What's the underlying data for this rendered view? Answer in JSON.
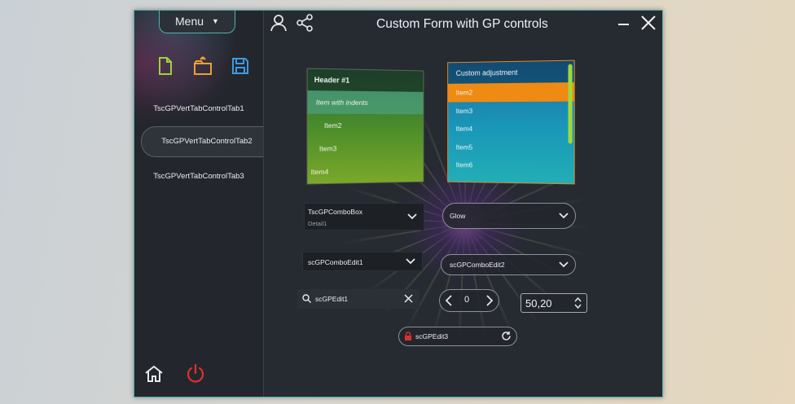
{
  "window": {
    "title": "Custom Form with GP controls",
    "accent_color": "#4fb3ad"
  },
  "sidebar": {
    "menu_label": "Menu",
    "toolbar_icons": [
      "new-file-icon",
      "open-folder-icon",
      "save-icon"
    ],
    "tabs": [
      {
        "label": "TscGPVertTabControlTab1",
        "active": false
      },
      {
        "label": "TscGPVertTabControlTab2",
        "active": true
      },
      {
        "label": "TscGPVertTabControlTab3",
        "active": false
      }
    ],
    "bottom_icons": [
      "home-icon",
      "power-icon"
    ]
  },
  "header_icons": [
    "user-icon",
    "share-icon",
    "minimize-icon",
    "close-icon"
  ],
  "list1": {
    "header": "Header #1",
    "items": [
      {
        "label": "Item with indents",
        "selected": true
      },
      {
        "label": "Item2",
        "selected": false
      },
      {
        "label": "Item3",
        "selected": false
      },
      {
        "label": "Item4",
        "selected": false
      }
    ]
  },
  "list2": {
    "header": "Custom adjustment",
    "items": [
      {
        "label": "Item2",
        "selected": true
      },
      {
        "label": "Item3",
        "selected": false
      },
      {
        "label": "Item4",
        "selected": false
      },
      {
        "label": "Item5",
        "selected": false
      },
      {
        "label": "Item6",
        "selected": false
      }
    ],
    "selection_color": "#ef8a12"
  },
  "combo_box": {
    "value": "TscGPComboBox",
    "detail": "Detail1"
  },
  "glow_combo": {
    "value": "Glow"
  },
  "combo_edit1": {
    "value": "scGPComboEdit1"
  },
  "combo_edit2": {
    "value": "scGPComboEdit2"
  },
  "search_edit": {
    "value": "scGPEdit1"
  },
  "spin_edit": {
    "value": "0"
  },
  "number_edit": {
    "value": "50,20"
  },
  "edit3": {
    "value": "scGPEdit3"
  }
}
